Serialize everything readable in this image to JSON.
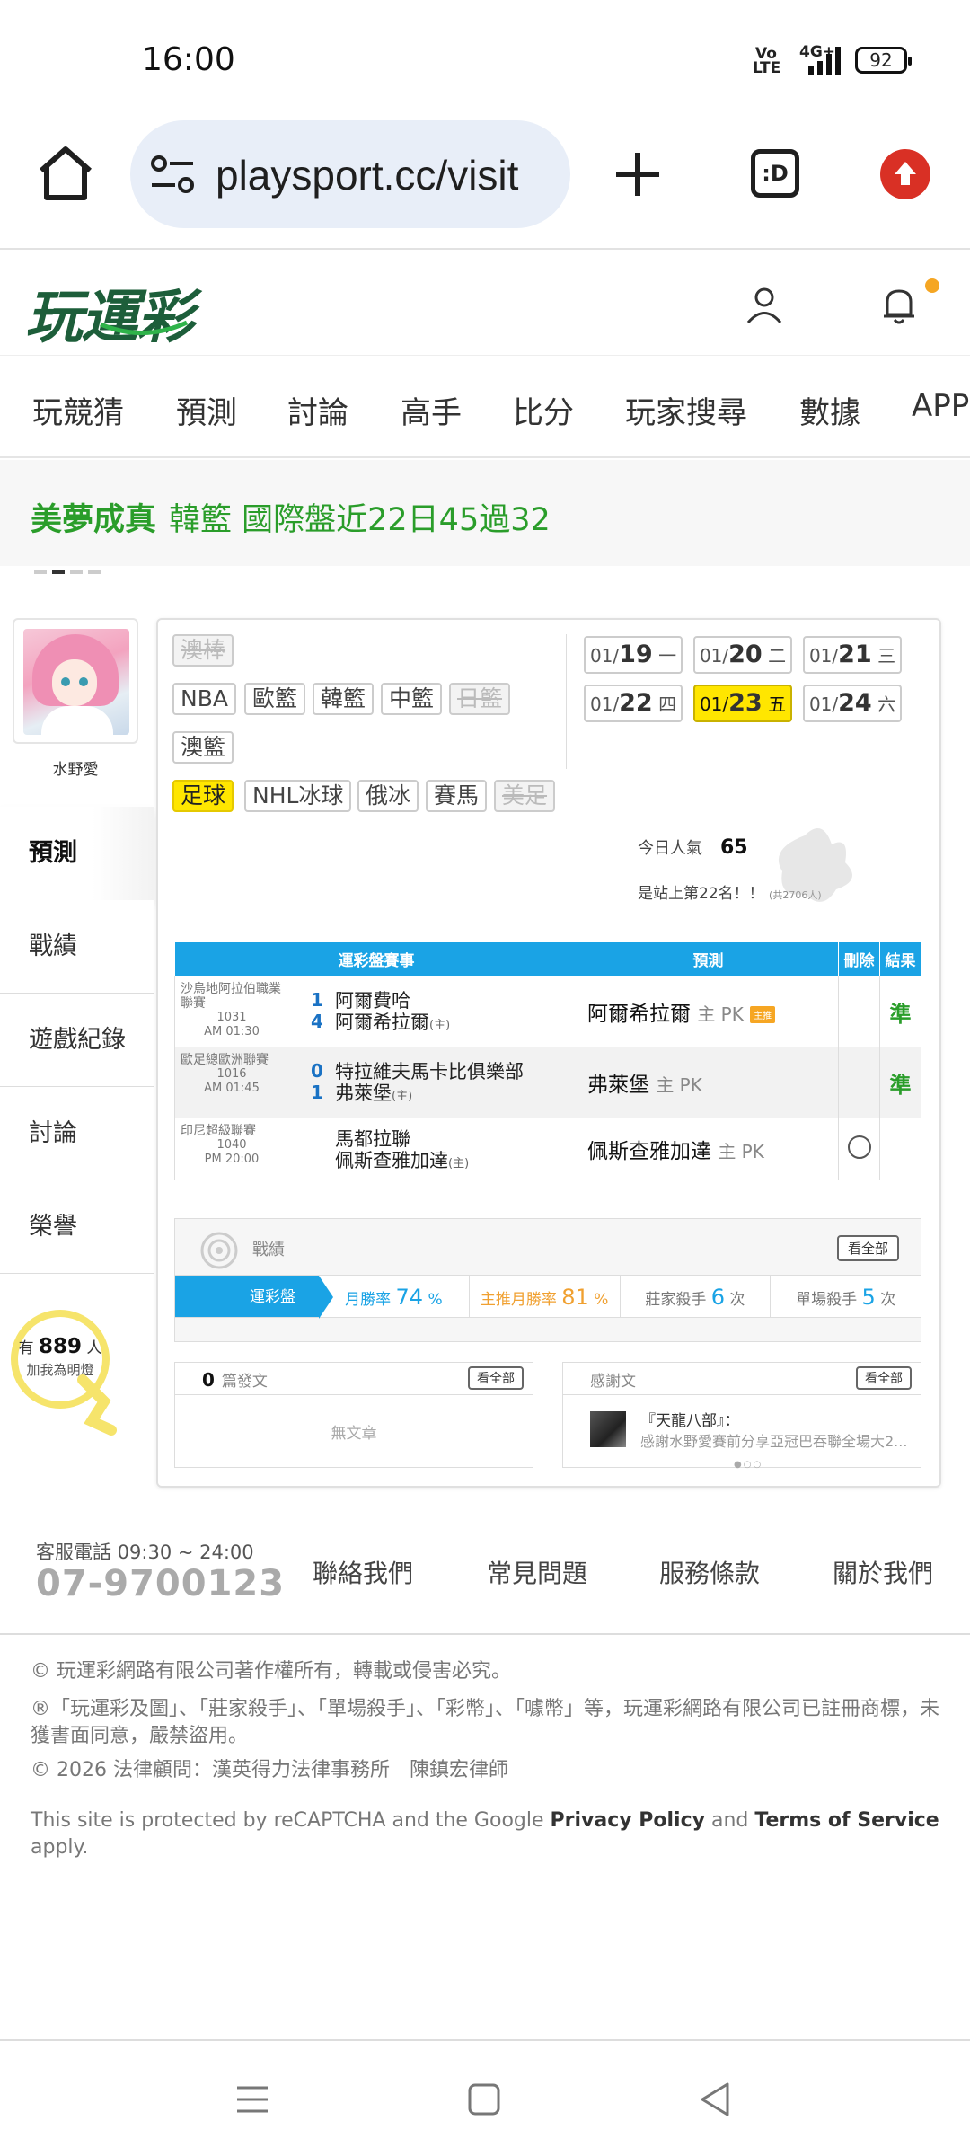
{
  "status_bar": {
    "time": "16:00",
    "volte": "Vo LTE",
    "network": "4G+",
    "battery": "92"
  },
  "browser": {
    "url": "playsport.cc/visit",
    "tabs_label": ":D"
  },
  "site": {
    "logo_text": "玩運彩"
  },
  "main_nav": [
    "玩競猜",
    "預測",
    "討論",
    "高手",
    "比分",
    "玩家搜尋",
    "數據",
    "APP"
  ],
  "banner": {
    "name": "美夢成真",
    "text": "韓籃 國際盤近22日45過32"
  },
  "profile": {
    "nickname": "水野愛",
    "side_menu": [
      "預測",
      "戰績",
      "遊戲紀錄",
      "討論",
      "榮譽"
    ],
    "fans_prefix": "有",
    "fans_count": "889",
    "fans_suffix": "人",
    "fans_action": "加我為明燈"
  },
  "sports_tags": {
    "row1": [
      "澳棒"
    ],
    "row2": [
      "NBA",
      "歐籃",
      "韓籃",
      "中籃",
      "日籃"
    ],
    "row3": [
      "澳籃"
    ],
    "row4": [
      "足球",
      "NHL冰球",
      "俄冰",
      "賽馬",
      "美足"
    ]
  },
  "dates": [
    {
      "md": "01/",
      "d": "19",
      "wd": "一"
    },
    {
      "md": "01/",
      "d": "20",
      "wd": "二"
    },
    {
      "md": "01/",
      "d": "21",
      "wd": "三"
    },
    {
      "md": "01/",
      "d": "22",
      "wd": "四"
    },
    {
      "md": "01/",
      "d": "23",
      "wd": "五"
    },
    {
      "md": "01/",
      "d": "24",
      "wd": "六"
    }
  ],
  "popularity": {
    "label": "今日人氣",
    "value": "65",
    "rank_text": "是站上第22名！！",
    "rank_total": "(共2706人)"
  },
  "table": {
    "headers": [
      "運彩盤賽事",
      "預測",
      "刪除",
      "結果"
    ],
    "rows": [
      {
        "league": "沙烏地阿拉伯職業聯賽",
        "code": "1031",
        "time": "AM 01:30",
        "score_a": "1",
        "team_a": "阿爾費哈",
        "score_b": "4",
        "team_b": "阿爾希拉爾",
        "host_mark": "(主)",
        "pred_team": "阿爾希拉爾",
        "pred_tag": "主 PK",
        "badge": "主推",
        "result": "準"
      },
      {
        "league": "歐足總歐洲聯賽",
        "code": "1016",
        "time": "AM 01:45",
        "score_a": "0",
        "team_a": "特拉維夫馬卡比俱樂部",
        "score_b": "1",
        "team_b": "弗萊堡",
        "host_mark": "(主)",
        "pred_team": "弗萊堡",
        "pred_tag": "主 PK",
        "result": "準"
      },
      {
        "league": "印尼超級聯賽",
        "code": "1040",
        "time": "PM 20:00",
        "score_a": "",
        "team_a": "馬都拉聯",
        "score_b": "",
        "team_b": "佩斯查雅加達",
        "host_mark": "(主)",
        "pred_team": "佩斯查雅加達",
        "pred_tag": "主 PK",
        "result": ""
      }
    ]
  },
  "record": {
    "title": "戰績",
    "view_all": "看全部",
    "tab": "運彩盤",
    "stats": [
      {
        "label": "月勝率",
        "value": "74",
        "unit": "%"
      },
      {
        "label": "主推月勝率",
        "value": "81",
        "unit": "%"
      },
      {
        "label": "莊家殺手",
        "value": "6",
        "unit": "次"
      },
      {
        "label": "單場殺手",
        "value": "5",
        "unit": "次"
      }
    ]
  },
  "posts": {
    "count": "0",
    "label": "篇發文",
    "view_all": "看全部",
    "empty": "無文章"
  },
  "thanks": {
    "label": "感謝文",
    "view_all": "看全部",
    "title": "『天龍八部』：",
    "body": "感謝水野愛賽前分享亞冠巴吞聯全場大2..."
  },
  "footer": {
    "cs_label": "客服電話 09:30 ~ 24:00",
    "phone": "07-9700123",
    "links": [
      "聯絡我們",
      "常見問題",
      "服務條款",
      "關於我們"
    ],
    "copyright": "© 玩運彩網路有限公司著作權所有，轉載或侵害必究。",
    "trademark": "®「玩運彩及圖」、「莊家殺手」、「單場殺手」、「彩幣」、「噱幣」等，玩運彩網路有限公司已註冊商標，未獲書面同意，嚴禁盜用。",
    "legal": "© 2026 法律顧問：漢英得力法律事務所　陳鎮宏律師",
    "recaptcha_prefix": "This site is protected by reCAPTCHA and the Google",
    "privacy": "Privacy Policy",
    "and": "and",
    "terms": "Terms of Service",
    "apply": "apply."
  }
}
